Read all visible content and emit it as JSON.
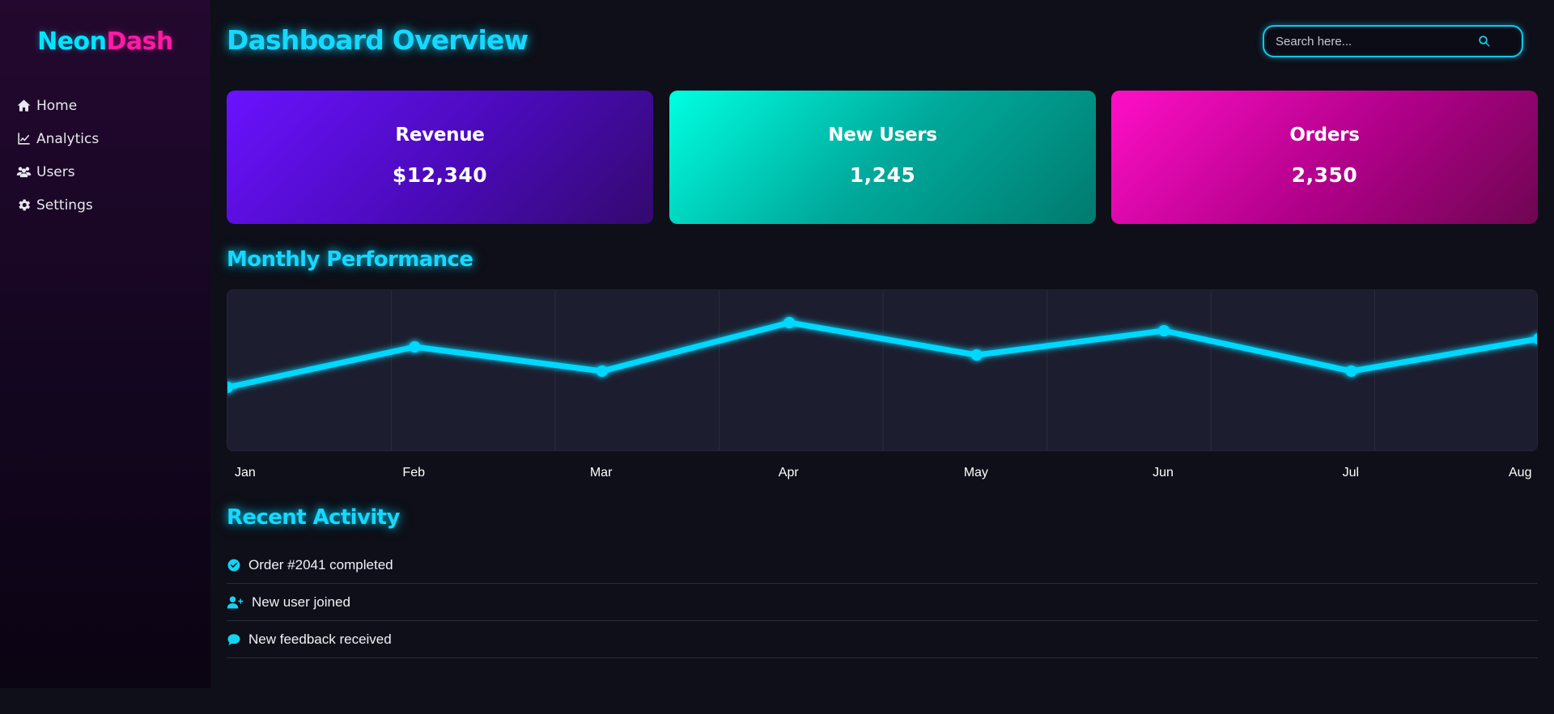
{
  "app": {
    "logo_part1": "Neon",
    "logo_part2": "Dash"
  },
  "sidebar": {
    "items": [
      {
        "label": "Home",
        "icon": "home-icon"
      },
      {
        "label": "Analytics",
        "icon": "chart-line-icon"
      },
      {
        "label": "Users",
        "icon": "users-icon"
      },
      {
        "label": "Settings",
        "icon": "gear-icon"
      }
    ]
  },
  "header": {
    "title": "Dashboard Overview",
    "search": {
      "placeholder": "Search here...",
      "value": "",
      "icon": "search-icon"
    }
  },
  "cards": [
    {
      "label": "Revenue",
      "value": "$12,340",
      "color": "#6a12ff"
    },
    {
      "label": "New Users",
      "value": "1,245",
      "color": "#00ffe1"
    },
    {
      "label": "Orders",
      "value": "2,350",
      "color": "#ff0fc6"
    }
  ],
  "performance": {
    "title": "Monthly Performance"
  },
  "chart_data": {
    "type": "line",
    "categories": [
      "Jan",
      "Feb",
      "Mar",
      "Apr",
      "May",
      "Jun",
      "Jul",
      "Aug"
    ],
    "values": [
      40,
      65,
      50,
      80,
      60,
      75,
      50,
      70
    ],
    "ylim": [
      0,
      100
    ],
    "color": "#00d8ff",
    "grid": true
  },
  "activity": {
    "title": "Recent Activity",
    "items": [
      {
        "text": "Order #2041 completed",
        "icon": "check-circle-icon"
      },
      {
        "text": "New user joined",
        "icon": "user-plus-icon"
      },
      {
        "text": "New feedback received",
        "icon": "comment-icon"
      }
    ]
  },
  "colors": {
    "accent": "#00d8ff",
    "brand_pink": "#ff1aa6",
    "background": "#0e0f18"
  }
}
